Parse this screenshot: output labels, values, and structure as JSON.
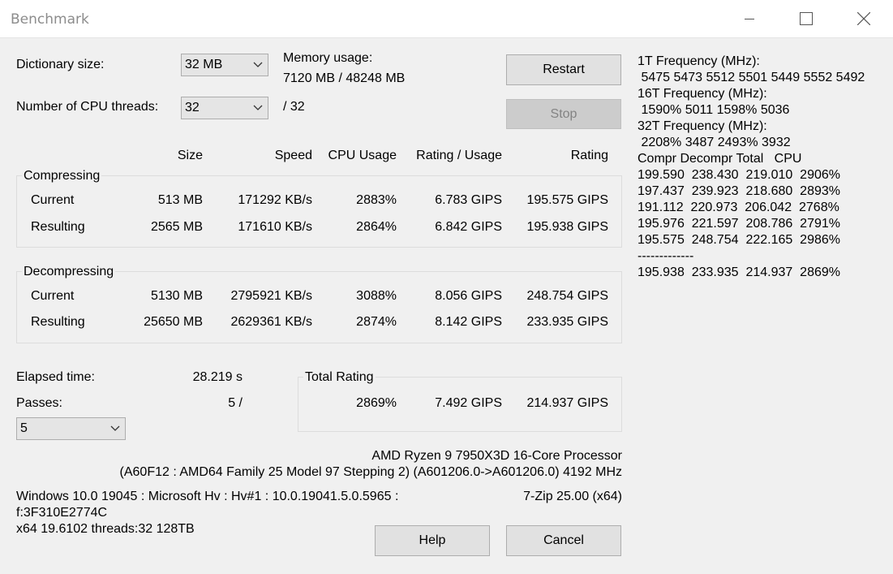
{
  "window": {
    "title": "Benchmark"
  },
  "settings": {
    "dict_label": "Dictionary size:",
    "dict_value": "32 MB",
    "threads_label": "Number of CPU threads:",
    "threads_value": "32",
    "threads_max": "/ 32",
    "mem_label": "Memory usage:",
    "mem_value": "7120 MB / 48248 MB"
  },
  "buttons": {
    "restart": "Restart",
    "stop": "Stop",
    "help": "Help",
    "cancel": "Cancel"
  },
  "columns": {
    "size": "Size",
    "speed": "Speed",
    "cpu_usage": "CPU Usage",
    "rating_usage": "Rating / Usage",
    "rating": "Rating"
  },
  "compressing": {
    "label": "Compressing",
    "rows": [
      {
        "name": "Current",
        "size": "513 MB",
        "speed": "171292 KB/s",
        "usage": "2883%",
        "rpu": "6.783 GIPS",
        "rating": "195.575 GIPS"
      },
      {
        "name": "Resulting",
        "size": "2565 MB",
        "speed": "171610 KB/s",
        "usage": "2864%",
        "rpu": "6.842 GIPS",
        "rating": "195.938 GIPS"
      }
    ]
  },
  "decompressing": {
    "label": "Decompressing",
    "rows": [
      {
        "name": "Current",
        "size": "5130 MB",
        "speed": "2795921 KB/s",
        "usage": "3088%",
        "rpu": "8.056 GIPS",
        "rating": "248.754 GIPS"
      },
      {
        "name": "Resulting",
        "size": "25650 MB",
        "speed": "2629361 KB/s",
        "usage": "2874%",
        "rpu": "8.142 GIPS",
        "rating": "233.935 GIPS"
      }
    ]
  },
  "stats": {
    "elapsed_label": "Elapsed time:",
    "elapsed_value": "28.219 s",
    "passes_label": "Passes:",
    "passes_value": "5 /",
    "passes_select": "5"
  },
  "total": {
    "label": "Total Rating",
    "usage": "2869%",
    "rpu": "7.492 GIPS",
    "rating": "214.937 GIPS"
  },
  "sysinfo": {
    "cpu_name": "AMD Ryzen 9 7950X3D 16-Core Processor",
    "cpu_detail": "(A60F12 : AMD64 Family 25 Model 97 Stepping 2) (A601206.0->A601206.0) 4192 MHz",
    "os_line": "Windows 10.0 19045 : Microsoft Hv : Hv#1 : 10.0.19041.5.0.5965 :",
    "os_id": "f:3F310E2774C",
    "arch_line": "x64 19.6102 threads:32 128TB",
    "version": "7-Zip 25.00 (x64)"
  },
  "side_panel": {
    "lines": [
      "1T Frequency (MHz):",
      " 5475 5473 5512 5501 5449 5552 5492",
      "16T Frequency (MHz):",
      " 1590% 5011 1598% 5036",
      "32T Frequency (MHz):",
      " 2208% 3487 2493% 3932",
      "Compr Decompr Total   CPU",
      "199.590  238.430  219.010  2906%",
      "197.437  239.923  218.680  2893%",
      "191.112  220.973  206.042  2768%",
      "195.976  221.597  208.786  2791%",
      "195.575  248.754  222.165  2986%",
      "-------------",
      "195.938  233.935  214.937  2869%"
    ]
  },
  "icons": {
    "minimize": "minimize-icon",
    "maximize": "maximize-icon",
    "close": "close-icon",
    "dropdown": "chevron-down-icon"
  }
}
